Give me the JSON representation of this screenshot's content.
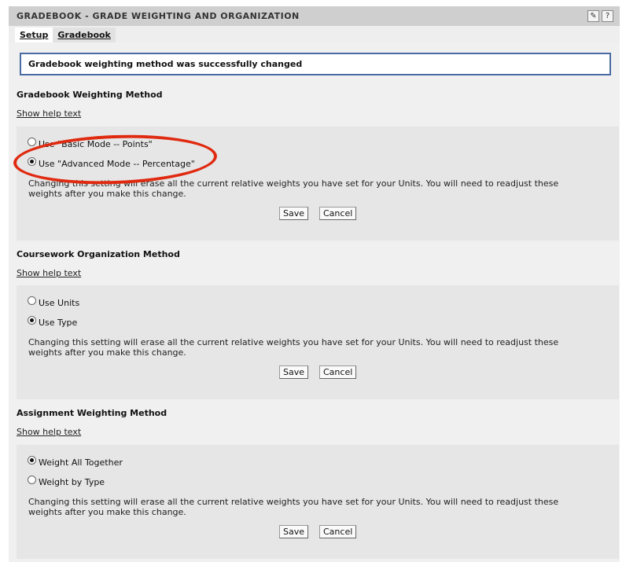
{
  "titlebar": {
    "title": "GRADEBOOK - GRADE WEIGHTING AND ORGANIZATION",
    "icons": [
      "tool-icon",
      "help-icon"
    ],
    "help_glyph": "?"
  },
  "tabs": [
    {
      "label": "Setup",
      "active": true
    },
    {
      "label": "Gradebook",
      "active": false
    }
  ],
  "message": "Gradebook weighting method was successfully changed",
  "sections": [
    {
      "title": "Gradebook Weighting Method",
      "help_link": "Show help text",
      "options": [
        {
          "label": "Use \"Basic Mode -- Points\"",
          "checked": false
        },
        {
          "label": "Use \"Advanced Mode -- Percentage\"",
          "checked": true
        }
      ],
      "note": "Changing this setting will erase all the current relative weights you have set for your Units. You will need to readjust these weights after you make this change.",
      "save_label": "Save",
      "cancel_label": "Cancel"
    },
    {
      "title": "Coursework Organization Method",
      "help_link": "Show help text",
      "options": [
        {
          "label": "Use Units",
          "checked": false
        },
        {
          "label": "Use Type",
          "checked": true
        }
      ],
      "note": "Changing this setting will erase all the current relative weights you have set for your Units. You will need to readjust these weights after you make this change.",
      "save_label": "Save",
      "cancel_label": "Cancel"
    },
    {
      "title": "Assignment Weighting Method",
      "help_link": "Show help text",
      "options": [
        {
          "label": "Weight All Together",
          "checked": true
        },
        {
          "label": "Weight by Type",
          "checked": false
        }
      ],
      "note": "Changing this setting will erase all the current relative weights you have set for your Units. You will need to readjust these weights after you make this change.",
      "save_label": "Save",
      "cancel_label": "Cancel"
    }
  ],
  "colors": {
    "highlight_oval": "#e02a10",
    "message_border": "#4b6ba3"
  }
}
